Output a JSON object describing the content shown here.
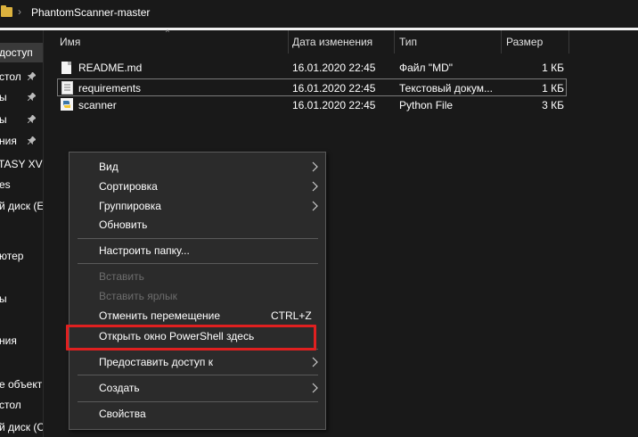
{
  "address": {
    "separator": "›",
    "path": "PhantomScanner-master"
  },
  "nav": {
    "items": [
      {
        "label": "доступ",
        "pinned": false,
        "active": true
      },
      {
        "label": "стол",
        "pinned": true
      },
      {
        "label": "ы",
        "pinned": true
      },
      {
        "label": "ы",
        "pinned": true
      },
      {
        "label": "ния",
        "pinned": true
      },
      {
        "label": "TASY XV",
        "pinned": false
      },
      {
        "label": "es",
        "pinned": false
      },
      {
        "label": "й диск (E",
        "pinned": false
      },
      {
        "label": "ютер",
        "pinned": false
      },
      {
        "label": "ы",
        "pinned": false
      },
      {
        "label": "ния",
        "pinned": false
      },
      {
        "label": "е объекты",
        "pinned": false
      },
      {
        "label": "стол",
        "pinned": false
      },
      {
        "label": "й диск (C",
        "pinned": false
      }
    ]
  },
  "columns": {
    "name": "Имя",
    "date": "Дата изменения",
    "type": "Тип",
    "size": "Размер"
  },
  "files": [
    {
      "name": "README.md",
      "date": "16.01.2020 22:45",
      "type": "Файл \"MD\"",
      "size": "1 КБ",
      "icon": "document-icon"
    },
    {
      "name": "requirements",
      "date": "16.01.2020 22:45",
      "type": "Текстовый докум...",
      "size": "1 КБ",
      "icon": "text-document-icon"
    },
    {
      "name": "scanner",
      "date": "16.01.2020 22:45",
      "type": "Python File",
      "size": "3 КБ",
      "icon": "python-file-icon"
    }
  ],
  "context_menu": {
    "items": [
      {
        "label": "Вид",
        "submenu": true
      },
      {
        "label": "Сортировка",
        "submenu": true
      },
      {
        "label": "Группировка",
        "submenu": true
      },
      {
        "label": "Обновить"
      },
      {
        "label": "Настроить папку..."
      },
      {
        "label": "Вставить",
        "disabled": true
      },
      {
        "label": "Вставить ярлык",
        "disabled": true
      },
      {
        "label": "Отменить перемещение",
        "shortcut": "CTRL+Z"
      },
      {
        "label": "Открыть окно PowerShell здесь"
      },
      {
        "label": "Предоставить доступ к",
        "submenu": true
      },
      {
        "label": "Создать",
        "submenu": true
      },
      {
        "label": "Свойства"
      }
    ]
  },
  "colors": {
    "background": "#191919",
    "menu_background": "#2b2b2b",
    "highlight_border": "#e02020",
    "folder": "#dcb23e"
  }
}
